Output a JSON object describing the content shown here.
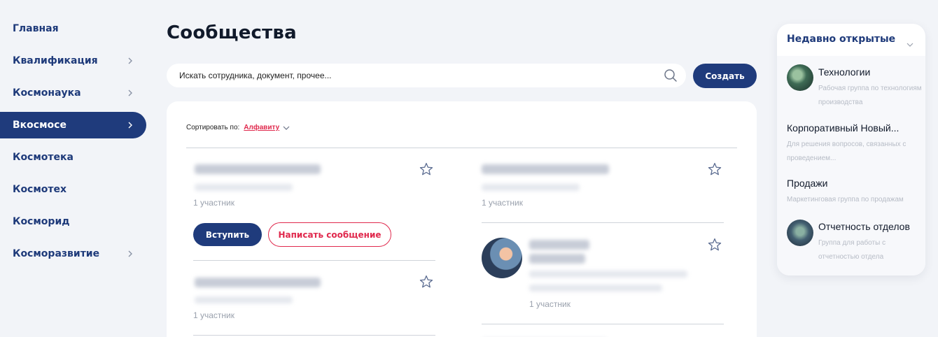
{
  "sidebar": {
    "items": [
      {
        "label": "Главная",
        "has_children": false,
        "active": false
      },
      {
        "label": "Квалификация",
        "has_children": true,
        "active": false
      },
      {
        "label": "Космонаука",
        "has_children": true,
        "active": false
      },
      {
        "label": "Вкосмосе",
        "has_children": true,
        "active": true
      },
      {
        "label": "Космотека",
        "has_children": false,
        "active": false
      },
      {
        "label": "Космотех",
        "has_children": false,
        "active": false
      },
      {
        "label": "Косморид",
        "has_children": false,
        "active": false
      },
      {
        "label": "Косморазвитие",
        "has_children": true,
        "active": false
      }
    ]
  },
  "main": {
    "title": "Сообщества",
    "search_placeholder": "Искать сотрудника, документ, прочее...",
    "create_label": "Создать",
    "sort_label": "Сортировать по:",
    "sort_value": "Алфавиту",
    "communities": [
      {
        "members": "1 участник",
        "join_label": "Вступить",
        "message_label": "Написать сообщение"
      },
      {
        "members": "1 участник"
      },
      {
        "members": "1 участник"
      },
      {
        "members": "1 участник"
      }
    ]
  },
  "recent": {
    "title": "Недавно открытые",
    "items": [
      {
        "name": "Технологии",
        "description": "Рабочая группа по технологиям производства",
        "icon": "photo-avatar"
      },
      {
        "name": "Корпоративный Новый...",
        "description": "Для решения вопросов, связанных с проведением..."
      },
      {
        "name": "Продажи",
        "description": "Маркетинговая группа по продажам"
      },
      {
        "name": "Отчетность отделов",
        "description": "Группа для работы с отчетностью отдела",
        "icon": "photo-avatar"
      }
    ]
  },
  "colors": {
    "primary": "#1f3b7c",
    "accent": "#e0294d",
    "background": "#f2f4f8"
  }
}
